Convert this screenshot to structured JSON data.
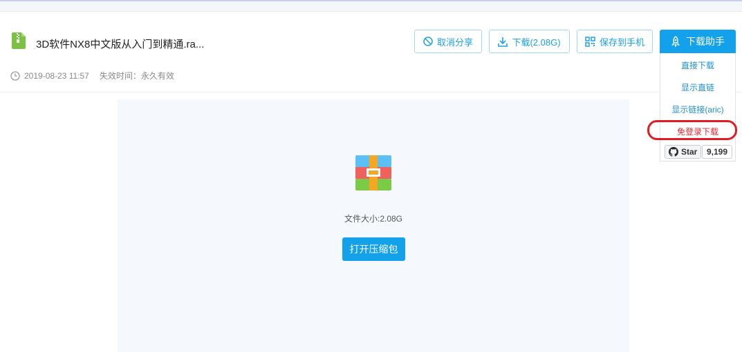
{
  "file": {
    "title": "3D软件NX8中文版从入门到精通.ra...",
    "date": "2019-08-23 11:57",
    "expiry": "失效时间：永久有效",
    "size_text": "文件大小:2.08G"
  },
  "toolbar": {
    "cancel_share": "取消分享",
    "download": "下载(2.08G)",
    "save_to_phone": "保存到手机",
    "download_helper": "下载助手"
  },
  "helper_menu": {
    "items": [
      "直接下载",
      "显示直链",
      "显示链接(aric)",
      "免登录下载"
    ]
  },
  "github": {
    "star_label": "Star",
    "star_count": "9,199"
  },
  "preview": {
    "open_button": "打开压缩包"
  },
  "colors": {
    "accent": "#12a1ea",
    "highlight": "#e21b23",
    "file_icon": "#7cc242"
  }
}
